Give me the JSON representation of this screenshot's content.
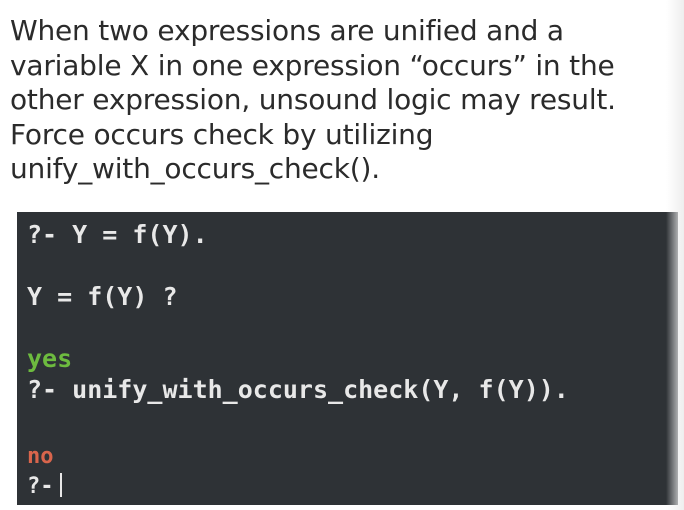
{
  "description": {
    "lines": [
      "When two expressions are unified and a",
      "variable X in one expression “occurs” in the",
      "other expression, unsound logic may result.",
      "Force occurs check by utilizing",
      "unify_with_occurs_check()."
    ]
  },
  "terminal": {
    "query_1": "?- Y = f(Y).",
    "answer_1": "Y = f(Y) ?",
    "result_1": "yes",
    "query_2": "?- unify_with_occurs_check(Y, f(Y)).",
    "result_2": "no",
    "prompt": "?-"
  },
  "colors": {
    "terminal_background": "#2e3236",
    "terminal_text": "#e8e8e8",
    "yes": "#6dbb3f",
    "no": "#d9654c"
  }
}
